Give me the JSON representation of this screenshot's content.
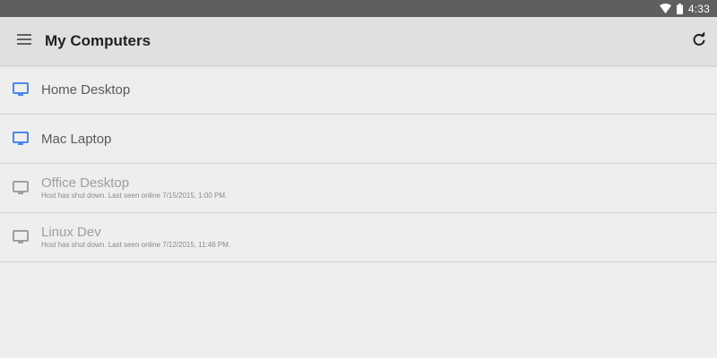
{
  "status_bar": {
    "time": "4:33",
    "icons": [
      "wifi-icon",
      "battery-icon"
    ]
  },
  "app_bar": {
    "title": "My Computers",
    "menu_icon": "menu-icon",
    "refresh_icon": "refresh-icon"
  },
  "colors": {
    "online_icon": "#4a86e8",
    "offline_icon": "#9e9e9e",
    "app_bar_bg": "#e0e0e0",
    "status_bar_bg": "#5f5f5f",
    "list_bg": "#eeeeee"
  },
  "hosts": [
    {
      "name": "Home Desktop",
      "status": "",
      "online": true,
      "icon": "monitor-icon"
    },
    {
      "name": "Mac Laptop",
      "status": "",
      "online": true,
      "icon": "monitor-icon"
    },
    {
      "name": "Office Desktop",
      "status": "Host has shut down. Last seen online 7/15/2015, 1:00 PM.",
      "online": false,
      "icon": "monitor-icon"
    },
    {
      "name": "Linux Dev",
      "status": "Host has shut down. Last seen online 7/12/2015, 11:46 PM.",
      "online": false,
      "icon": "monitor-icon"
    }
  ]
}
